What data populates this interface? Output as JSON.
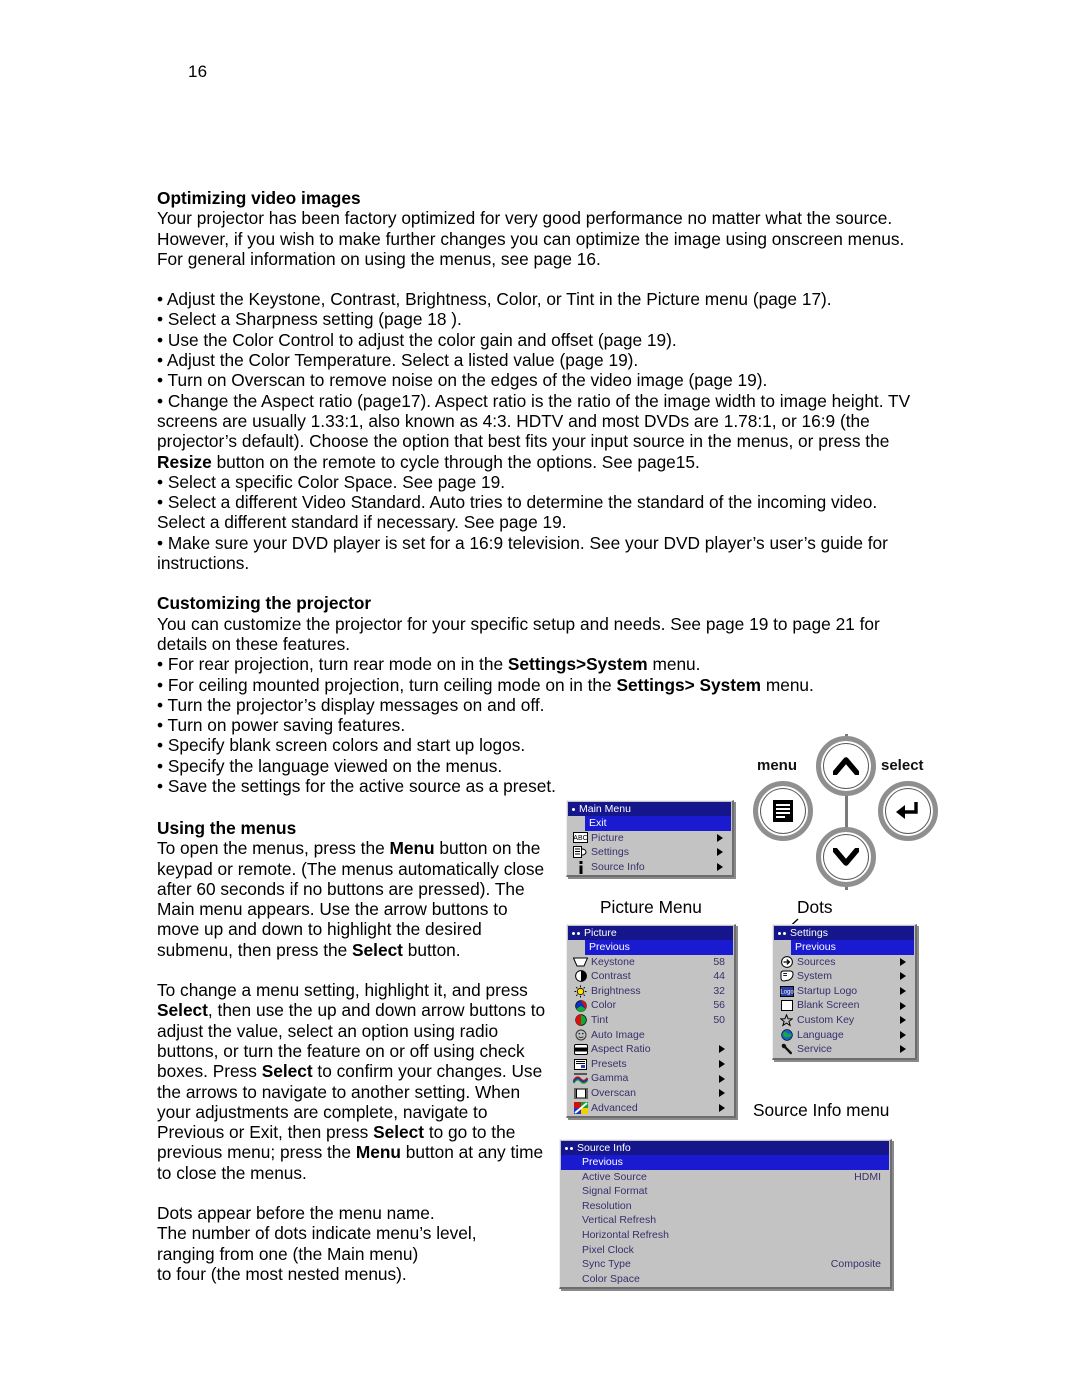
{
  "page": {
    "number": "16"
  },
  "sections": {
    "optimizing": {
      "heading": "Optimizing video images",
      "intro": "Your projector has been factory optimized for very good performance no matter what the source. However, if you wish to make further changes you can optimize the image using onscreen menus. For general information on using the menus, see page 16.",
      "bullets": [
        "• Adjust the Keystone, Contrast, Brightness, Color, or Tint in the Picture menu (page 17).",
        "• Select a Sharpness setting (page 18 ).",
        "• Use the Color Control to adjust the color gain and offset (page 19).",
        "• Adjust the Color Temperature. Select a listed value (page 19).",
        "• Turn on Overscan to remove noise on the edges of the video image (page 19)."
      ],
      "aspect_bullet_pre": "• Change the Aspect ratio (page17). Aspect ratio is the ratio of the image width to image height. TV screens are usually 1.33:1, also known as 4:3. HDTV and most DVDs are 1.78:1, or 16:9 (the projector’s default). Choose the option that best fits your input source in the menus, or press the ",
      "aspect_bullet_bold": "Resize",
      "aspect_bullet_post": " button on the remote to cycle through the options. See page15.",
      "bullets2": [
        "• Select a specific Color Space. See page 19.",
        "• Select a different Video Standard. Auto tries to determine the standard of the incoming video. Select a different standard if necessary. See page 19.",
        "• Make sure your DVD player is set for a 16:9 television. See your DVD player’s user’s guide for instructions."
      ]
    },
    "customizing": {
      "heading": "Customizing the projector",
      "intro": "You can customize the projector for your specific setup and needs. See page 19 to page 21 for details on these features.",
      "b1_pre": "• For rear projection, turn rear mode on in the ",
      "b1_bold": "Settings>System",
      "b1_post": " menu.",
      "b2_pre": "• For ceiling mounted projection, turn ceiling mode on in the ",
      "b2_bold": "Settings> System",
      "b2_post": " menu.",
      "bullets": [
        "• Turn the projector’s display messages on and off.",
        "• Turn on power saving features.",
        "• Specify blank screen colors and start up logos.",
        "• Specify the language viewed on the menus.",
        "• Save the settings for the active source as a preset."
      ]
    },
    "using_menus": {
      "heading": "Using the menus",
      "p1_a": "To open the menus, press the ",
      "p1_menu": "Menu",
      "p1_b": " button on the keypad or remote. (The menus automatically close after 60 seconds if no buttons are pressed). The Main menu appears. Use the arrow buttons to move up and down to highlight the desired submenu, then press the ",
      "p1_select": "Select",
      "p1_c": " button.",
      "p2_a": "To change a menu setting, highlight it, and press ",
      "p2_select1": "Select",
      "p2_b": ", then use the up and down arrow buttons to adjust the value, select an option using radio buttons, or turn the feature on or off using check boxes. Press ",
      "p2_select2": "Select",
      "p2_c": " to confirm your changes. Use the arrows to navigate to another setting. When your adjustments are complete, navigate to Previous or Exit, then press ",
      "p2_select3": "Select",
      "p2_d": " to go to the previous menu; press the ",
      "p2_menu": "Menu",
      "p2_e": " button at any time to close the menus.",
      "p3": "Dots appear before the menu name.\nThe number of dots indicate menu’s level,\nranging from one (the Main menu)\nto four (the most nested menus)."
    }
  },
  "keypad": {
    "menu_label": "menu",
    "select_label": "select",
    "menu_icon": "menu-lines-icon",
    "select_icon": "enter-arrow-icon",
    "up_icon": "chevron-up-icon",
    "down_icon": "chevron-down-icon"
  },
  "callouts": {
    "picture_menu": "Picture Menu",
    "dots": "Dots",
    "source_info_menu": "Source Info menu"
  },
  "menus": {
    "main": {
      "title": "Main Menu",
      "dot_count": 1,
      "rows": [
        {
          "label": "Exit",
          "selected": true,
          "icon": ""
        },
        {
          "label": "Picture",
          "icon": "abc-icon",
          "arrow": true
        },
        {
          "label": "Settings",
          "icon": "settings-icon",
          "arrow": true
        },
        {
          "label": "Source Info",
          "icon": "info-icon",
          "arrow": true
        }
      ]
    },
    "picture": {
      "title": "Picture",
      "dot_count": 2,
      "rows": [
        {
          "label": "Previous",
          "selected": true,
          "icon": ""
        },
        {
          "label": "Keystone",
          "icon": "keystone-icon",
          "value": "58"
        },
        {
          "label": "Contrast",
          "icon": "contrast-icon",
          "value": "44"
        },
        {
          "label": "Brightness",
          "icon": "brightness-icon",
          "value": "32"
        },
        {
          "label": "Color",
          "icon": "color-icon",
          "value": "56"
        },
        {
          "label": "Tint",
          "icon": "tint-icon",
          "value": "50"
        },
        {
          "label": "Auto Image",
          "icon": "auto-image-icon"
        },
        {
          "label": "Aspect Ratio",
          "icon": "aspect-ratio-icon",
          "arrow": true
        },
        {
          "label": "Presets",
          "icon": "presets-icon",
          "arrow": true
        },
        {
          "label": "Gamma",
          "icon": "gamma-icon",
          "arrow": true
        },
        {
          "label": "Overscan",
          "icon": "overscan-icon",
          "arrow": true
        },
        {
          "label": "Advanced",
          "icon": "advanced-icon",
          "arrow": true
        }
      ]
    },
    "settings": {
      "title": "Settings",
      "dot_count": 2,
      "rows": [
        {
          "label": "Previous",
          "selected": true,
          "icon": ""
        },
        {
          "label": "Sources",
          "icon": "sources-icon",
          "arrow": true
        },
        {
          "label": "System",
          "icon": "system-icon",
          "arrow": true
        },
        {
          "label": "Startup Logo",
          "icon": "startup-logo-icon",
          "arrow": true
        },
        {
          "label": "Blank Screen",
          "icon": "blank-screen-icon",
          "arrow": true
        },
        {
          "label": "Custom Key",
          "icon": "star-icon",
          "arrow": true
        },
        {
          "label": "Language",
          "icon": "globe-icon",
          "arrow": true
        },
        {
          "label": "Service",
          "icon": "wrench-icon",
          "arrow": true
        }
      ]
    },
    "source_info": {
      "title": "Source Info",
      "dot_count": 2,
      "rows": [
        {
          "label": "Previous",
          "selected": true
        },
        {
          "label": "Active Source",
          "value": "HDMI"
        },
        {
          "label": "Signal Format",
          "value": ""
        },
        {
          "label": "Resolution",
          "value": ""
        },
        {
          "label": "Vertical Refresh",
          "value": ""
        },
        {
          "label": "Horizontal Refresh",
          "value": ""
        },
        {
          "label": "Pixel Clock",
          "value": ""
        },
        {
          "label": "Sync Type",
          "value": "Composite"
        },
        {
          "label": "Color Space",
          "value": ""
        }
      ]
    }
  },
  "colors": {
    "menu_title_bg": "#15168c",
    "menu_highlight_bg": "#1a1ad0",
    "menu_body_bg": "#c3c3c3",
    "menu_text": "#3a2f6b"
  }
}
